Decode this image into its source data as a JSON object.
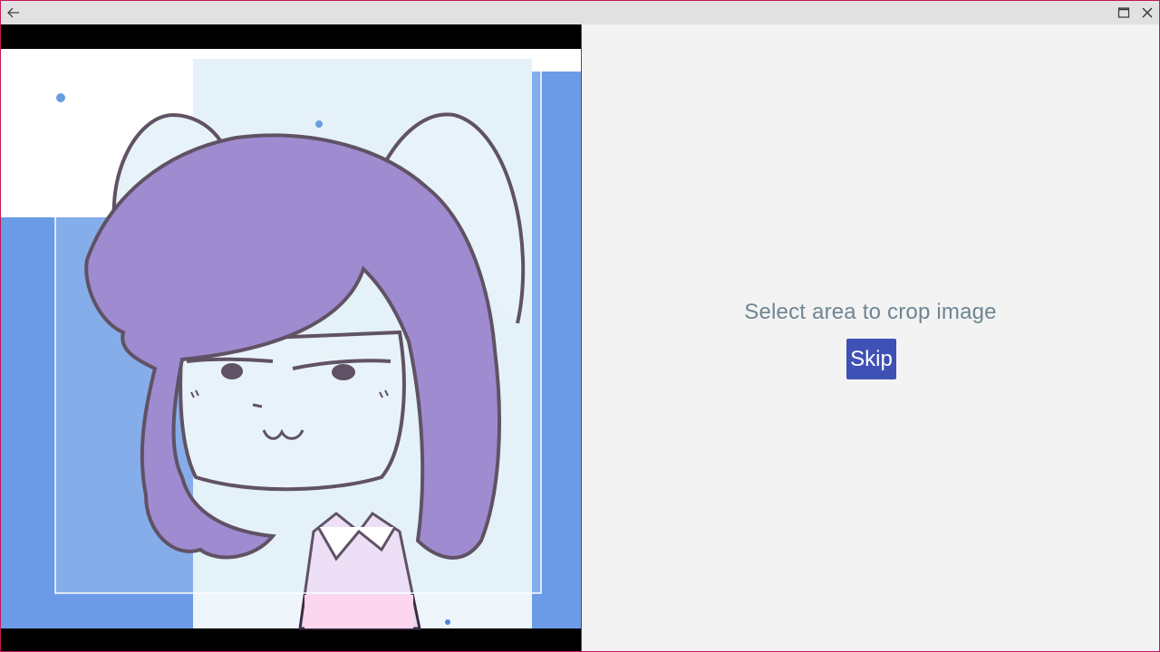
{
  "titlebar": {
    "back_icon": "arrow-left-icon",
    "maximize_icon": "maximize-icon",
    "close_icon": "close-icon"
  },
  "cropper": {
    "image_description": "photo",
    "frame_color": "#ffffff"
  },
  "side_panel": {
    "prompt": "Select area to crop image",
    "skip_label": "Skip"
  },
  "colors": {
    "accent": "#3f51b5",
    "window_border": "#c2185b",
    "prompt_text": "#6e8592"
  }
}
